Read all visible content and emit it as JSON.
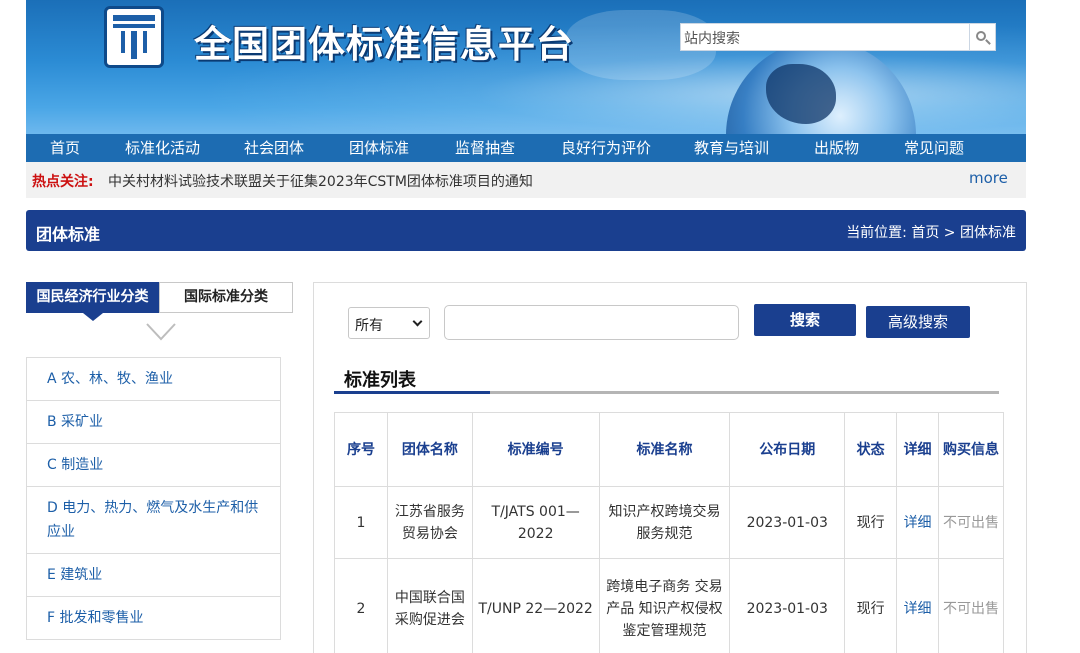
{
  "header": {
    "site_title": "全国团体标准信息平台",
    "search_placeholder": "站内搜索"
  },
  "nav": {
    "items": [
      "首页",
      "标准化活动",
      "社会团体",
      "团体标准",
      "监督抽查",
      "良好行为评价",
      "教育与培训",
      "出版物",
      "常见问题"
    ]
  },
  "hot": {
    "label": "热点关注:",
    "news": "中关村材料试验技术联盟关于征集2023年CSTM团体标准项目的通知",
    "more": "more"
  },
  "section": {
    "title": "团体标准",
    "breadcrumb": "当前位置: 首页 > 团体标准"
  },
  "left": {
    "tab_active": "国民经济行业分类",
    "tab_inactive": "国际标准分类",
    "categories": [
      "A 农、林、牧、渔业",
      "B 采矿业",
      "C 制造业",
      "D 电力、热力、燃气及水生产和供应业",
      "E 建筑业",
      "F 批发和零售业"
    ]
  },
  "search": {
    "select_value": "所有",
    "search_button": "搜索",
    "advanced_button": "高级搜索"
  },
  "list": {
    "title": "标准列表",
    "columns": [
      "序号",
      "团体名称",
      "标准编号",
      "标准名称",
      "公布日期",
      "状态",
      "详细",
      "购买信息"
    ],
    "rows": [
      {
        "no": "1",
        "org": "江苏省服务贸易协会",
        "code": "T/JATS 001—2022",
        "name": "知识产权跨境交易服务规范",
        "date": "2023-01-03",
        "status": "现行",
        "detail": "详细",
        "buy": "不可出售"
      },
      {
        "no": "2",
        "org": "中国联合国采购促进会",
        "code": "T/UNP 22—2022",
        "name": "跨境电子商务 交易产品 知识产权侵权鉴定管理规范",
        "date": "2023-01-03",
        "status": "现行",
        "detail": "详细",
        "buy": "不可出售"
      }
    ]
  }
}
